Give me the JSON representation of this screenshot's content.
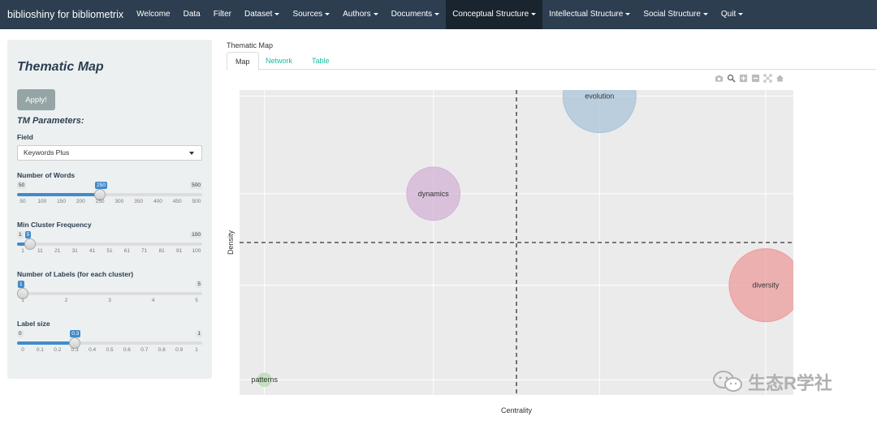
{
  "navbar": {
    "brand": "biblioshiny for bibliometrix",
    "items": [
      {
        "label": "Welcome",
        "dropdown": false,
        "active": false
      },
      {
        "label": "Data",
        "dropdown": false,
        "active": false
      },
      {
        "label": "Filter",
        "dropdown": false,
        "active": false
      },
      {
        "label": "Dataset",
        "dropdown": true,
        "active": false
      },
      {
        "label": "Sources",
        "dropdown": true,
        "active": false
      },
      {
        "label": "Authors",
        "dropdown": true,
        "active": false
      },
      {
        "label": "Documents",
        "dropdown": true,
        "active": false
      },
      {
        "label": "Conceptual Structure",
        "dropdown": true,
        "active": true
      },
      {
        "label": "Intellectual Structure",
        "dropdown": true,
        "active": false
      },
      {
        "label": "Social Structure",
        "dropdown": true,
        "active": false
      },
      {
        "label": "Quit",
        "dropdown": true,
        "active": false
      }
    ]
  },
  "sidebar": {
    "title": "Thematic Map",
    "apply_label": "Apply!",
    "params_title": "TM Parameters:",
    "field": {
      "label": "Field",
      "value": "Keywords Plus"
    },
    "sliders": [
      {
        "label": "Number of Words",
        "min": "50",
        "max": "500",
        "value": "250",
        "fraction": 0.4444,
        "ticks": [
          "50",
          "100",
          "150",
          "200",
          "250",
          "300",
          "350",
          "400",
          "450",
          "500"
        ]
      },
      {
        "label": "Min Cluster Frequency",
        "min": "1",
        "max": "100",
        "value": "5",
        "fraction": 0.0404,
        "ticks": [
          "1",
          "11",
          "21",
          "31",
          "41",
          "51",
          "61",
          "71",
          "81",
          "91",
          "100"
        ]
      },
      {
        "label": "Number of Labels (for each cluster)",
        "min": "1",
        "max": "5",
        "value": "1",
        "fraction": 0.0,
        "ticks": [
          "1",
          "2",
          "3",
          "4",
          "5"
        ]
      },
      {
        "label": "Label size",
        "min": "0",
        "max": "1",
        "value": "0.3",
        "fraction": 0.3,
        "ticks": [
          "0",
          "0.1",
          "0.2",
          "0.3",
          "0.4",
          "0.5",
          "0.6",
          "0.7",
          "0.8",
          "0.9",
          "1"
        ]
      }
    ]
  },
  "main": {
    "title": "Thematic Map",
    "tabs": [
      {
        "label": "Map",
        "active": true
      },
      {
        "label": "Network",
        "active": false
      },
      {
        "label": "Table",
        "active": false
      }
    ],
    "modebar_icons": [
      "camera-icon",
      "zoom-icon",
      "zoom-in-icon",
      "zoom-out-icon",
      "autoscale-icon",
      "home-icon"
    ]
  },
  "chart_data": {
    "type": "scatter",
    "xlabel": "Centrality",
    "ylabel": "Density",
    "grid": true,
    "legend": "none",
    "quadrant_lines": {
      "x": 0.5,
      "y": 0.5,
      "style": "dashed"
    },
    "points": [
      {
        "label": "evolution",
        "x": 0.65,
        "y": 0.98,
        "size": 1.0,
        "color": "#a9c4da"
      },
      {
        "label": "dynamics",
        "x": 0.35,
        "y": 0.66,
        "size": 0.73,
        "color": "#d3b3d6"
      },
      {
        "label": "diversity",
        "x": 0.95,
        "y": 0.36,
        "size": 1.0,
        "color": "#ec9c9c"
      },
      {
        "label": "patterns",
        "x": 0.045,
        "y": 0.05,
        "size": 0.18,
        "color": "#b6dbb0"
      }
    ]
  },
  "watermark": {
    "text": "生态R学社",
    "icon": "wechat-icon"
  }
}
